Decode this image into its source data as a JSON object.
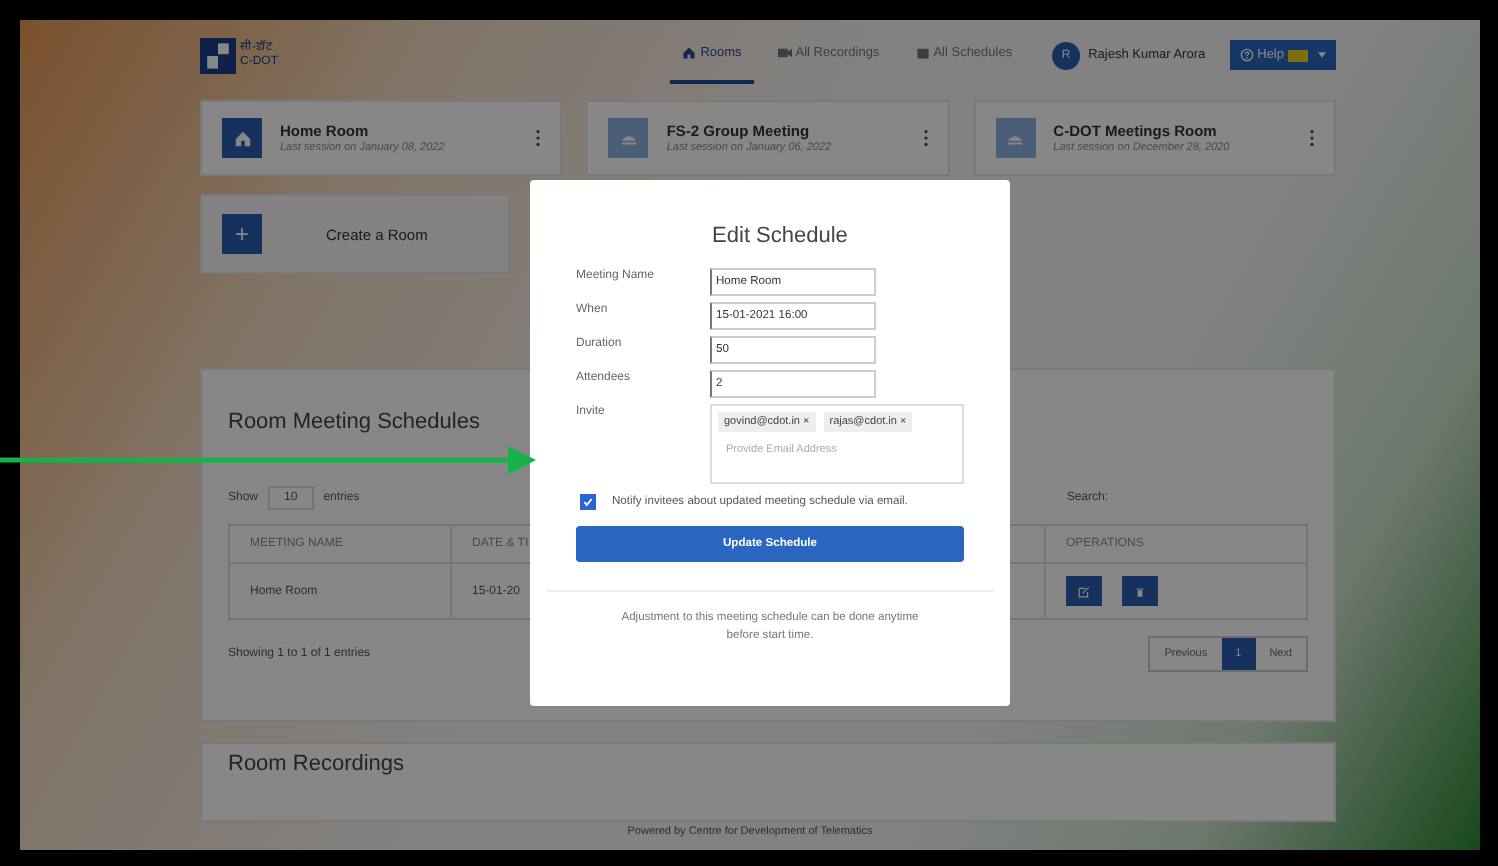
{
  "header": {
    "logo_text": "सी-डॉट",
    "logo_subtext": "C-DOT",
    "nav": [
      {
        "label": "Rooms",
        "kind": "home",
        "selected": true
      },
      {
        "label": "All Recordings",
        "kind": "video",
        "selected": false
      },
      {
        "label": "All Schedules",
        "kind": "calendar",
        "selected": false
      }
    ],
    "user": {
      "initial": "R",
      "name": "Rajesh Kumar Arora"
    },
    "help": {
      "label": "Help"
    }
  },
  "rooms": [
    {
      "name": "Home Room",
      "last": "Last session on January 08, 2022",
      "kind": "home"
    },
    {
      "name": "FS-2 Group Meeting",
      "last": "Last session on January 06, 2022",
      "kind": "meeting"
    },
    {
      "name": "C-DOT Meetings Room",
      "last": "Last session on December 28, 2020",
      "kind": "meeting"
    }
  ],
  "create_room": {
    "icon": "+",
    "label": "Create a Room"
  },
  "schedules": {
    "title": "Room Meeting Schedules",
    "show_label": "Show",
    "page_size": "10",
    "entries_label": "entries",
    "search_label": "Search:",
    "columns": [
      "MEETING NAME",
      "DATE & TI",
      "OPERATIONS"
    ],
    "rows": [
      {
        "cells": [
          "Home Room",
          "15-01-20"
        ]
      }
    ],
    "info": "Showing 1 to 1 of 1 entries",
    "pagination": [
      {
        "label": "Previous",
        "selected": false
      },
      {
        "label": "1",
        "selected": true
      },
      {
        "label": "Next",
        "selected": false
      }
    ]
  },
  "recordings": {
    "title": "Room Recordings"
  },
  "footer": "Powered by Centre for Development of Telematics",
  "modal": {
    "title": "Edit Schedule",
    "fields": [
      {
        "label": "Meeting Name",
        "value": "Home Room"
      },
      {
        "label": "When",
        "value": "15-01-2021 16:00"
      },
      {
        "label": "Duration",
        "value": "50"
      },
      {
        "label": "Attendees",
        "value": "2"
      }
    ],
    "invite": {
      "label": "Invite",
      "tags": [
        {
          "email": "govind@cdot.in",
          "remove": "×"
        },
        {
          "email": "rajas@cdot.in",
          "remove": "×"
        }
      ],
      "placeholder": "Provide Email Address"
    },
    "notify": {
      "label": "Notify invitees about updated meeting schedule via email.",
      "checked": true
    },
    "submit": "Update Schedule",
    "note": "Adjustment to this meeting schedule can be done anytime before start time."
  }
}
